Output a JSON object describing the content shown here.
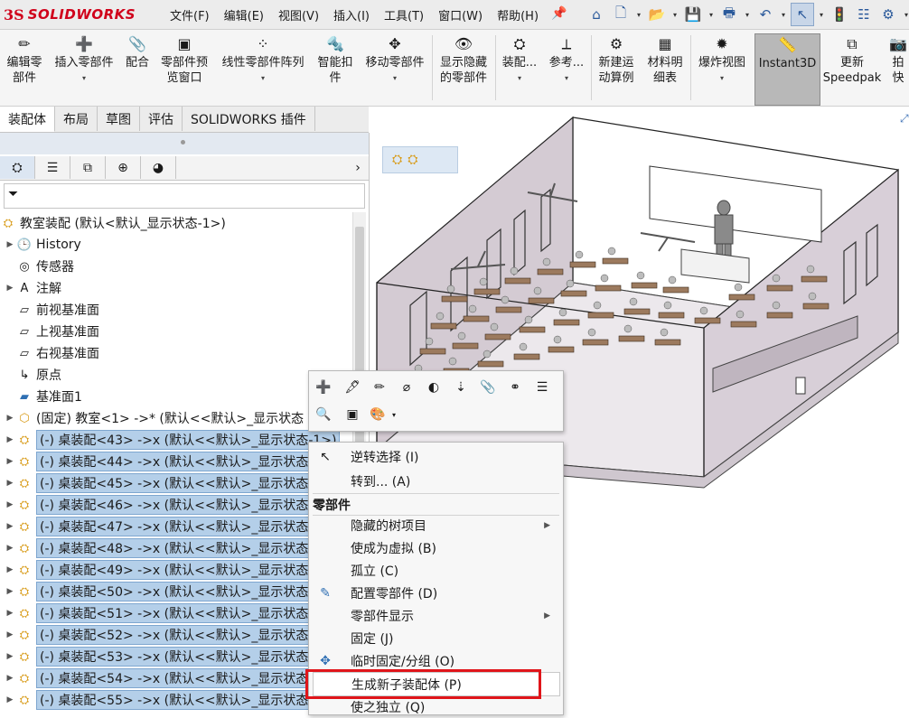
{
  "app": {
    "logo_prefix": "3S",
    "logo_text": "SOLIDWORKS",
    "menus": [
      "文件(F)",
      "编辑(E)",
      "视图(V)",
      "插入(I)",
      "工具(T)",
      "窗口(W)",
      "帮助(H)"
    ]
  },
  "ribbon": {
    "buttons": [
      {
        "label": "编辑零\n部件",
        "icon": "edit-component-icon"
      },
      {
        "label": "插入零部件",
        "icon": "insert-component-icon"
      },
      {
        "label": "配合",
        "icon": "mate-icon"
      },
      {
        "label": "零部件预\n览窗口",
        "icon": "component-preview-icon"
      },
      {
        "label": "线性零部件阵列",
        "icon": "linear-pattern-icon"
      },
      {
        "label": "智能扣\n件",
        "icon": "smart-fasteners-icon"
      },
      {
        "label": "移动零部件",
        "icon": "move-component-icon"
      },
      {
        "label": "显示隐藏\n的零部件",
        "icon": "show-hidden-icon"
      },
      {
        "label": "装配...",
        "icon": "assembly-features-icon"
      },
      {
        "label": "参考...",
        "icon": "reference-geometry-icon"
      },
      {
        "label": "新建运\n动算例",
        "icon": "new-motion-study-icon"
      },
      {
        "label": "材料明\n细表",
        "icon": "bill-of-materials-icon"
      },
      {
        "label": "爆炸视图",
        "icon": "exploded-view-icon"
      },
      {
        "label": "Instant3D",
        "icon": "instant3d-icon"
      },
      {
        "label": "更新\nSpeedpak",
        "icon": "speedpak-icon"
      },
      {
        "label": "拍快",
        "icon": "snapshot-icon"
      }
    ]
  },
  "tabs": [
    "装配体",
    "布局",
    "草图",
    "评估",
    "SOLIDWORKS 插件"
  ],
  "tree": {
    "root": "教室装配 (默认<默认_显示状态-1>)",
    "items": [
      {
        "label": "History",
        "icon": "history-icon",
        "expandable": true
      },
      {
        "label": "传感器",
        "icon": "sensor-icon",
        "expandable": false
      },
      {
        "label": "注解",
        "icon": "annotation-icon",
        "expandable": true
      },
      {
        "label": "前视基准面",
        "icon": "plane-icon",
        "expandable": false
      },
      {
        "label": "上视基准面",
        "icon": "plane-icon",
        "expandable": false
      },
      {
        "label": "右视基准面",
        "icon": "plane-icon",
        "expandable": false
      },
      {
        "label": "原点",
        "icon": "origin-icon",
        "expandable": false
      },
      {
        "label": "基准面1",
        "icon": "plane-blue-icon",
        "expandable": false
      },
      {
        "label": "(固定) 教室<1> ->* (默认<<默认>_显示状态",
        "icon": "part-icon",
        "expandable": true
      }
    ],
    "selected": [
      "(-) 桌装配<43> ->x (默认<<默认>_显示状态-1>)",
      "(-) 桌装配<44> ->x (默认<<默认>_显示状态",
      "(-) 桌装配<45> ->x (默认<<默认>_显示状态",
      "(-) 桌装配<46> ->x (默认<<默认>_显示状态",
      "(-) 桌装配<47> ->x (默认<<默认>_显示状态",
      "(-) 桌装配<48> ->x (默认<<默认>_显示状态",
      "(-) 桌装配<49> ->x (默认<<默认>_显示状态",
      "(-) 桌装配<50> ->x (默认<<默认>_显示状态",
      "(-) 桌装配<51> ->x (默认<<默认>_显示状态",
      "(-) 桌装配<52> ->x (默认<<默认>_显示状态",
      "(-) 桌装配<53> ->x (默认<<默认>_显示状态",
      "(-) 桌装配<54> ->x (默认<<默认>_显示状态",
      "(-) 桌装配<55> ->x (默认<<默认>_显示状态"
    ]
  },
  "context_menu": {
    "items": [
      {
        "label": "逆转选择 (I)",
        "icon": "invert-selection-icon",
        "submenu": false
      },
      {
        "label": "转到... (A)",
        "icon": "",
        "submenu": false
      }
    ],
    "section_header": "零部件",
    "component_items": [
      {
        "label": "隐藏的树项目",
        "icon": "",
        "submenu": true
      },
      {
        "label": "使成为虚拟 (B)",
        "icon": "",
        "submenu": false
      },
      {
        "label": "孤立 (C)",
        "icon": "",
        "submenu": false
      },
      {
        "label": "配置零部件 (D)",
        "icon": "configure-component-icon",
        "submenu": false
      },
      {
        "label": "零部件显示",
        "icon": "",
        "submenu": true
      },
      {
        "label": "固定 (J)",
        "icon": "",
        "submenu": false
      },
      {
        "label": "临时固定/分组 (O)",
        "icon": "temp-fix-icon",
        "submenu": false
      },
      {
        "label": "生成新子装配体 (P)",
        "icon": "",
        "submenu": false,
        "highlighted": true
      },
      {
        "label": "使之独立 (Q)",
        "icon": "",
        "submenu": false
      }
    ]
  },
  "colors": {
    "selection": "#b4cfe9",
    "highlight_box": "#e0151a",
    "brand": "#d0021b"
  }
}
